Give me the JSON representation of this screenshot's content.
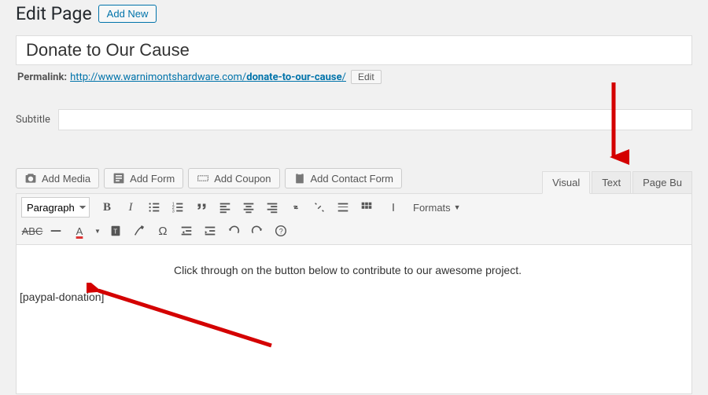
{
  "header": {
    "title": "Edit Page",
    "add_new": "Add New"
  },
  "post": {
    "title": "Donate to Our Cause"
  },
  "permalink": {
    "label": "Permalink:",
    "base": "http://www.warnimontshardware.com/",
    "slug": "donate-to-our-cause",
    "trail": "/",
    "edit": "Edit"
  },
  "subtitle": {
    "label": "Subtitle",
    "value": ""
  },
  "media": {
    "add_media": "Add Media",
    "add_form": "Add Form",
    "add_coupon": "Add Coupon",
    "add_contact_form": "Add Contact Form"
  },
  "tabs": {
    "visual": "Visual",
    "text": "Text",
    "page_builder": "Page Bu"
  },
  "toolbar": {
    "paragraph": "Paragraph",
    "formats": "Formats"
  },
  "content": {
    "line1": "Click through on the button below to contribute to our awesome project.",
    "shortcode": "[paypal-donation]"
  }
}
